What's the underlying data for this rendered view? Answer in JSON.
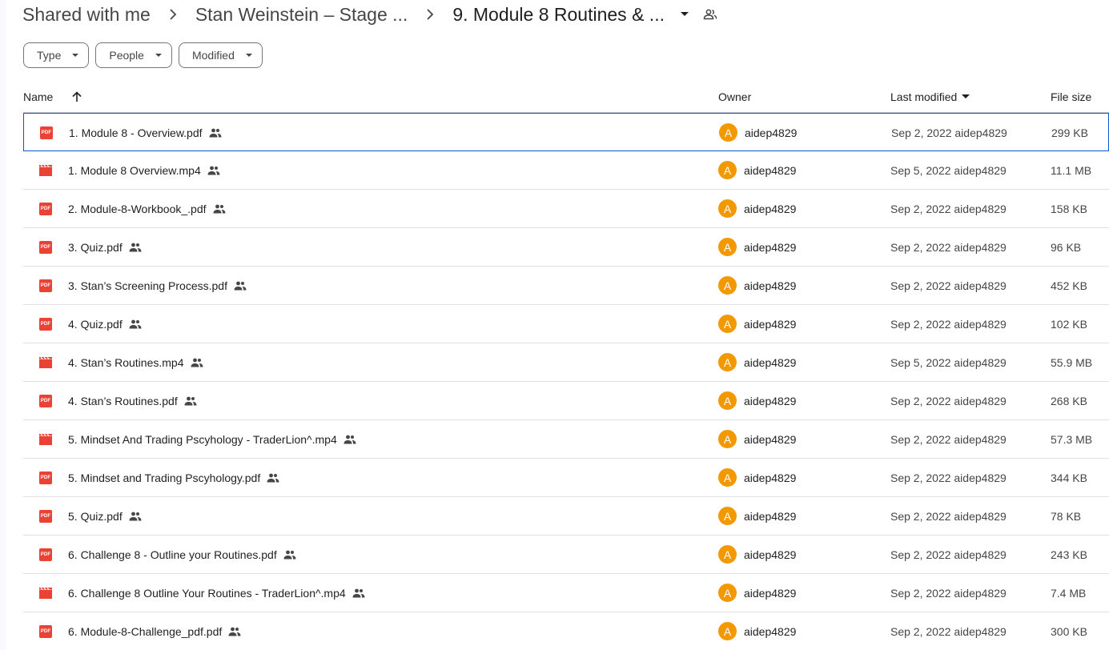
{
  "breadcrumb": {
    "items": [
      "Shared with me",
      "Stan Weinstein – Stage ...",
      "9. Module 8 Routines & ..."
    ]
  },
  "filters": [
    "Type",
    "People",
    "Modified"
  ],
  "columns": {
    "name": "Name",
    "owner": "Owner",
    "last_modified": "Last modified",
    "file_size": "File size"
  },
  "files": [
    {
      "name": "1. Module 8 - Overview.pdf",
      "type": "pdf",
      "owner_initial": "A",
      "owner": "aidep4829",
      "modified": "Sep 2, 2022 aidep4829",
      "size": "299 KB"
    },
    {
      "name": "1. Module 8 Overview.mp4",
      "type": "video",
      "owner_initial": "A",
      "owner": "aidep4829",
      "modified": "Sep 5, 2022 aidep4829",
      "size": "11.1 MB"
    },
    {
      "name": "2. Module-8-Workbook_.pdf",
      "type": "pdf",
      "owner_initial": "A",
      "owner": "aidep4829",
      "modified": "Sep 2, 2022 aidep4829",
      "size": "158 KB"
    },
    {
      "name": "3. Quiz.pdf",
      "type": "pdf",
      "owner_initial": "A",
      "owner": "aidep4829",
      "modified": "Sep 2, 2022 aidep4829",
      "size": "96 KB"
    },
    {
      "name": "3. Stan’s Screening Process.pdf",
      "type": "pdf",
      "owner_initial": "A",
      "owner": "aidep4829",
      "modified": "Sep 2, 2022 aidep4829",
      "size": "452 KB"
    },
    {
      "name": "4. Quiz.pdf",
      "type": "pdf",
      "owner_initial": "A",
      "owner": "aidep4829",
      "modified": "Sep 2, 2022 aidep4829",
      "size": "102 KB"
    },
    {
      "name": "4. Stan’s Routines.mp4",
      "type": "video",
      "owner_initial": "A",
      "owner": "aidep4829",
      "modified": "Sep 5, 2022 aidep4829",
      "size": "55.9 MB"
    },
    {
      "name": "4. Stan’s Routines.pdf",
      "type": "pdf",
      "owner_initial": "A",
      "owner": "aidep4829",
      "modified": "Sep 2, 2022 aidep4829",
      "size": "268 KB"
    },
    {
      "name": "5. Mindset And Trading Pscyhology - TraderLion^.mp4",
      "type": "video",
      "owner_initial": "A",
      "owner": "aidep4829",
      "modified": "Sep 2, 2022 aidep4829",
      "size": "57.3 MB"
    },
    {
      "name": "5. Mindset and Trading Pscyhology.pdf",
      "type": "pdf",
      "owner_initial": "A",
      "owner": "aidep4829",
      "modified": "Sep 2, 2022 aidep4829",
      "size": "344 KB"
    },
    {
      "name": "5. Quiz.pdf",
      "type": "pdf",
      "owner_initial": "A",
      "owner": "aidep4829",
      "modified": "Sep 2, 2022 aidep4829",
      "size": "78 KB"
    },
    {
      "name": "6. Challenge 8 - Outline your Routines.pdf",
      "type": "pdf",
      "owner_initial": "A",
      "owner": "aidep4829",
      "modified": "Sep 2, 2022 aidep4829",
      "size": "243 KB"
    },
    {
      "name": "6. Challenge 8 Outline Your Routines - TraderLion^.mp4",
      "type": "video",
      "owner_initial": "A",
      "owner": "aidep4829",
      "modified": "Sep 2, 2022 aidep4829",
      "size": "7.4 MB"
    },
    {
      "name": "6. Module-8-Challenge_pdf.pdf",
      "type": "pdf",
      "owner_initial": "A",
      "owner": "aidep4829",
      "modified": "Sep 2, 2022 aidep4829",
      "size": "300 KB"
    }
  ],
  "icons": {
    "pdf_label": "PDF",
    "pdf_color": "#ea4335",
    "video_color": "#ea4335",
    "avatar_color": "#f29900",
    "selection_color": "#0b57d0"
  }
}
